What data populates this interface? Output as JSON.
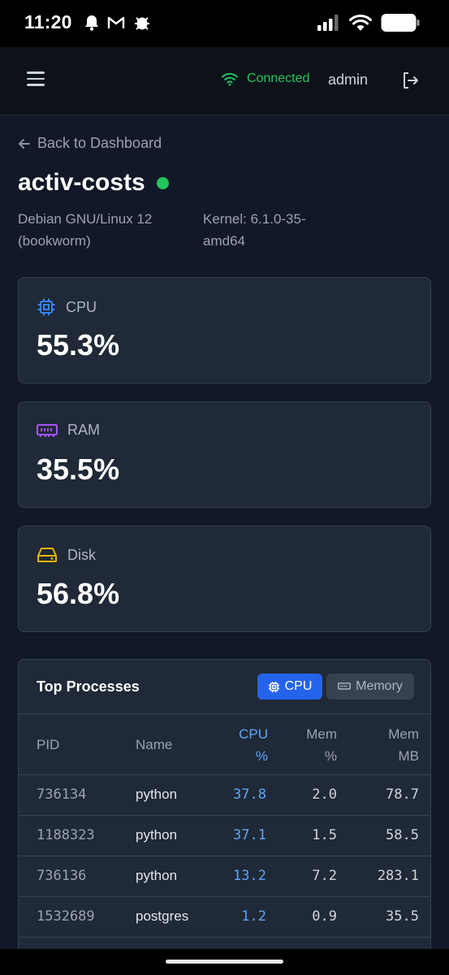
{
  "status_bar": {
    "time": "11:20",
    "notification_icons": [
      "bell-icon",
      "gmail-icon",
      "bug-icon"
    ],
    "system_icons": [
      "signal-icon",
      "wifi-icon",
      "battery-icon"
    ]
  },
  "header": {
    "connection_label": "Connected",
    "connection_color": "#22c55e",
    "user": "admin"
  },
  "server": {
    "back_label": "Back to Dashboard",
    "name": "activ-costs",
    "status": "online",
    "os": "Debian GNU/Linux 12 (bookworm)",
    "kernel": "Kernel: 6.1.0-35-amd64"
  },
  "metrics": [
    {
      "label": "CPU",
      "value": "55.3%",
      "icon": "cpu-chip-icon",
      "color": "#3b82f6"
    },
    {
      "label": "RAM",
      "value": "35.5%",
      "icon": "memory-icon",
      "color": "#a855f7"
    },
    {
      "label": "Disk",
      "value": "56.8%",
      "icon": "disk-icon",
      "color": "#eab308"
    }
  ],
  "processes": {
    "title": "Top Processes",
    "sort_cpu_label": "CPU",
    "sort_memory_label": "Memory",
    "columns": {
      "pid": "PID",
      "name": "Name",
      "cpu": [
        "CPU",
        "%"
      ],
      "mem": [
        "Mem",
        "%"
      ],
      "mb": [
        "Mem",
        "MB"
      ]
    },
    "rows": [
      {
        "pid": "736134",
        "name": "python",
        "cpu": "37.8",
        "mem": "2.0",
        "mb": "78.7"
      },
      {
        "pid": "1188323",
        "name": "python",
        "cpu": "37.1",
        "mem": "1.5",
        "mb": "58.5"
      },
      {
        "pid": "736136",
        "name": "python",
        "cpu": "13.2",
        "mem": "7.2",
        "mb": "283.1"
      },
      {
        "pid": "1532689",
        "name": "postgres",
        "cpu": "1.2",
        "mem": "0.9",
        "mb": "35.5"
      }
    ]
  }
}
